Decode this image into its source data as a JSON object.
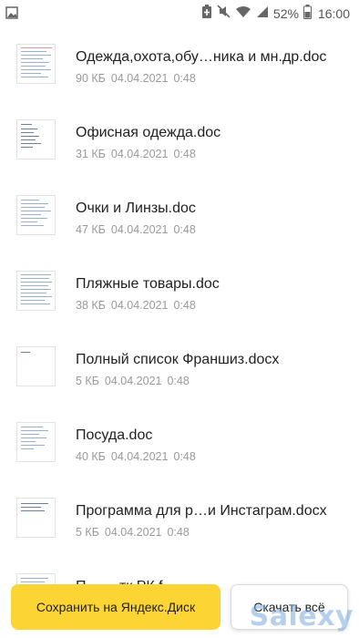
{
  "status_bar": {
    "battery_percent": "52%",
    "time": "16:00",
    "icons": [
      "image-icon",
      "battery-saver-icon",
      "mute-icon",
      "wifi-icon",
      "signal-icon",
      "battery-icon"
    ]
  },
  "files": [
    {
      "name": "Одежда,охота,обу…ника и мн.др.doc",
      "size": "90 КБ",
      "date": "04.04.2021",
      "time": "0:48"
    },
    {
      "name": "Офисная одежда.doc",
      "size": "31 КБ",
      "date": "04.04.2021",
      "time": "0:48"
    },
    {
      "name": "Очки и Линзы.doc",
      "size": "47 КБ",
      "date": "04.04.2021",
      "time": "0:48"
    },
    {
      "name": "Пляжные товары.doc",
      "size": "38 КБ",
      "date": "04.04.2021",
      "time": "0:48"
    },
    {
      "name": "Полный список Франшиз.docx",
      "size": "5 КБ",
      "date": "04.04.2021",
      "time": "0:48"
    },
    {
      "name": "Посуда.doc",
      "size": "40 КБ",
      "date": "04.04.2021",
      "time": "0:48"
    },
    {
      "name": "Программа для р…и Инстаграм.docx",
      "size": "5 КБ",
      "date": "04.04.2021",
      "time": "0:48"
    },
    {
      "name": "П…                  …тк РК.f",
      "size": "",
      "date": "",
      "time": ""
    }
  ],
  "buttons": {
    "save_label": "Сохранить на Яндекс.Диск",
    "download_label": "Скачать всё"
  },
  "watermark": "Salexy",
  "colors": {
    "accent_yellow": "#fcd535",
    "meta_gray": "#9a9a9a"
  }
}
